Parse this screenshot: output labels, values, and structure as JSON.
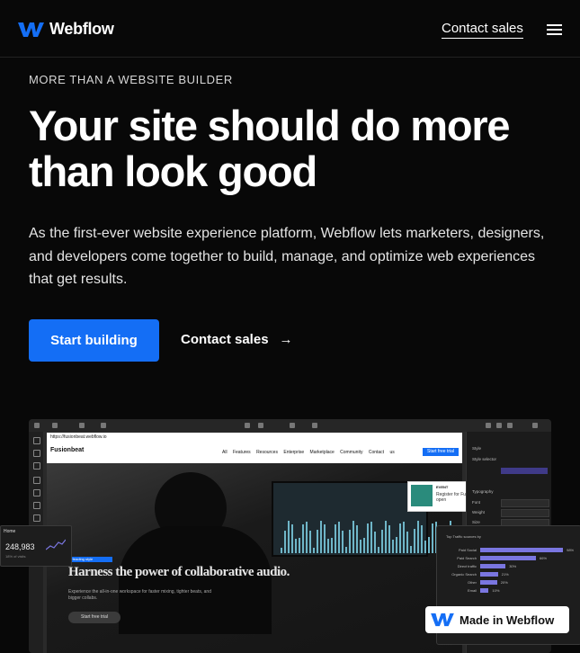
{
  "nav": {
    "logo_text": "Webflow",
    "contact_label": "Contact sales"
  },
  "hero": {
    "eyebrow": "MORE THAN A WEBSITE BUILDER",
    "headline": "Your site should do more than look good",
    "lead": "As the first-ever website experience platform, Webflow lets marketers, designers, and developers come together to build, manage, and optimize web experiences that get results.",
    "primary_cta": "Start building",
    "secondary_cta": "Contact sales"
  },
  "preview": {
    "site_address": "https://fusionbeat.webflow.io",
    "brand": "Fusionbeat",
    "site_links": "All Features Resources Enterprise Marketplace Community Contact us",
    "site_cta": "Start free trial",
    "hero_tag": "Heading style",
    "hero_title": "Harness the power of collaborative audio.",
    "hero_sub": "Experience the all-in-one workspace for faster mixing, tighter beats, and bigger collabs.",
    "hero_button": "Start free trial",
    "promo_label": "EVENT",
    "promo_text": "Register for FusionCon to open",
    "panel": {
      "style_label": "Style",
      "selectors": "Style selector",
      "typography": "Typography",
      "font": "Font",
      "weight": "Weight",
      "size": "Size"
    }
  },
  "stats_card": {
    "title": "Home",
    "value": "248,983",
    "sub": "18% of visits"
  },
  "traffic_card": {
    "title": "Top Traffic sources by",
    "rows": [
      {
        "label": "Paid Social",
        "value": "98%",
        "pct": 0.98
      },
      {
        "label": "Paid Search",
        "value": "66%",
        "pct": 0.66
      },
      {
        "label": "Direct traffic",
        "value": "30%",
        "pct": 0.3
      },
      {
        "label": "Organic Search",
        "value": "21%",
        "pct": 0.21
      },
      {
        "label": "Other",
        "value": "20%",
        "pct": 0.2
      },
      {
        "label": "Email",
        "value": "10%",
        "pct": 0.1
      }
    ]
  },
  "badge": {
    "text": "Made in Webflow"
  },
  "colors": {
    "accent": "#146ef5",
    "background": "#080808",
    "chart_bar": "#7a76e0"
  }
}
